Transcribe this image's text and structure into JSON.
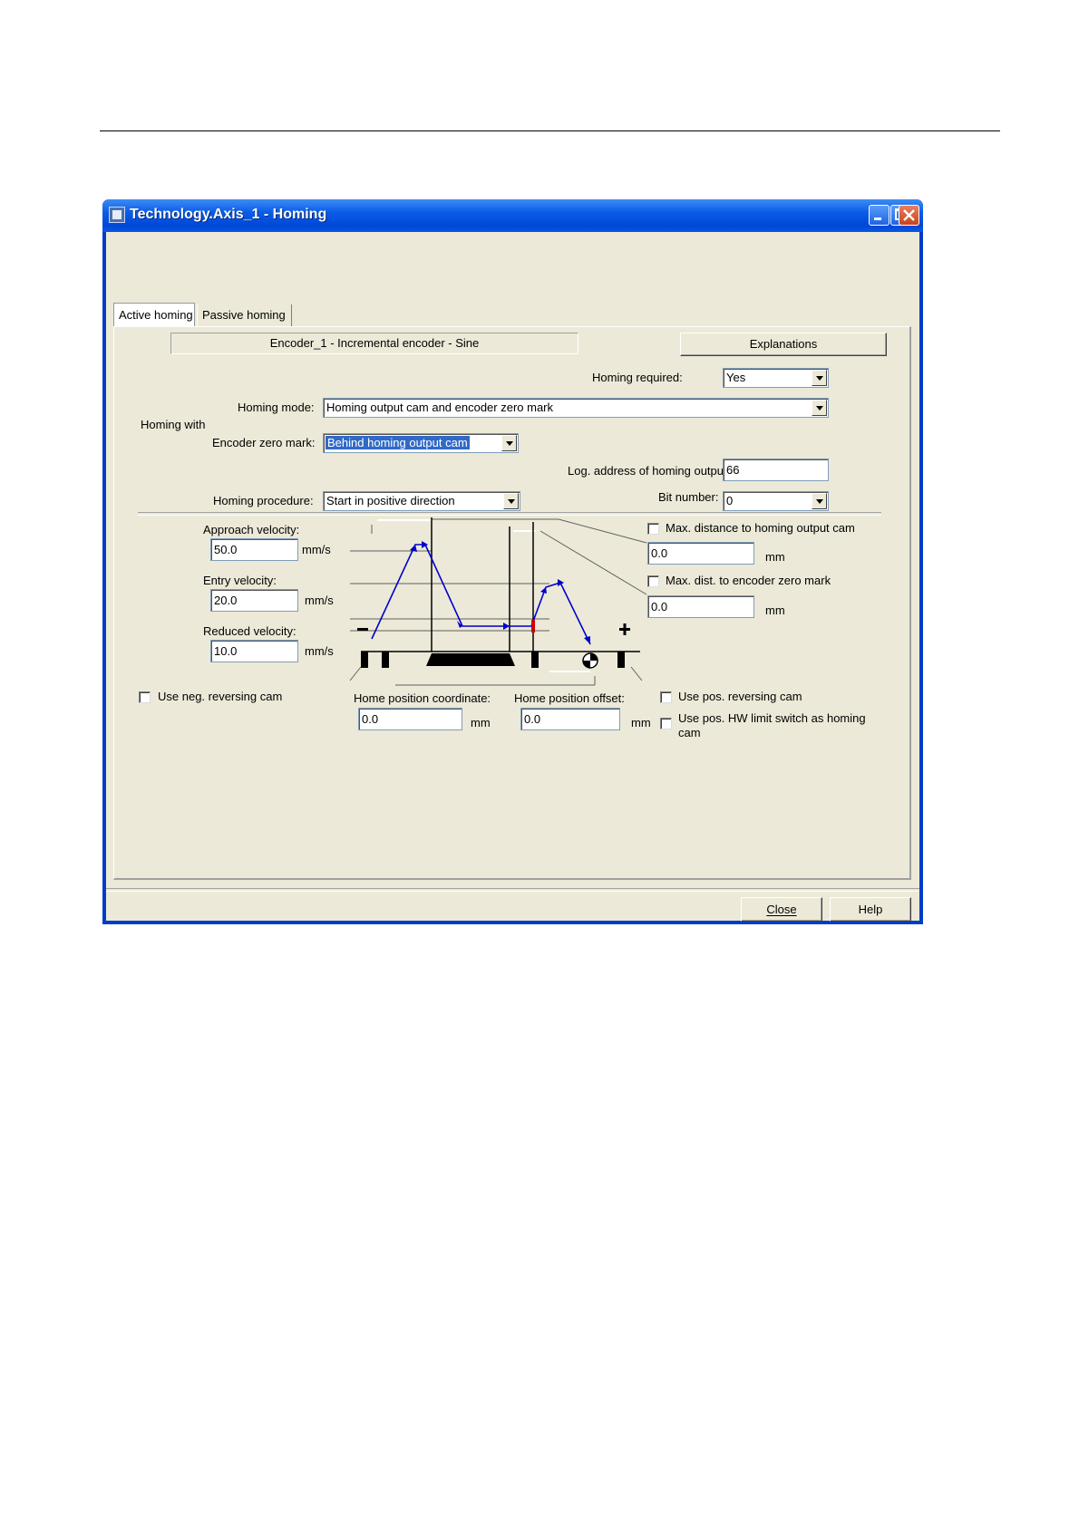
{
  "window": {
    "title": "Technology.Axis_1 - Homing",
    "controls": {
      "minimize_icon": "minimize-icon",
      "maximize_icon": "maximize-icon",
      "close_icon": "close-icon"
    }
  },
  "tabs": [
    {
      "label": "Active homing",
      "active": true
    },
    {
      "label": "Passive homing",
      "active": false
    }
  ],
  "encoder_label": "Encoder_1 - Incremental encoder - Sine",
  "explanations_button": "Explanations",
  "homing_required": {
    "label": "Homing required:",
    "value": "Yes"
  },
  "homing_with_label": "Homing with",
  "homing_mode": {
    "label": "Homing mode:",
    "value": "Homing output cam and encoder zero mark"
  },
  "encoder_zero_mark": {
    "label": "Encoder zero mark:",
    "value": "Behind homing output cam"
  },
  "log_address": {
    "label": "Log. address of homing output",
    "value": "66"
  },
  "homing_procedure": {
    "label": "Homing procedure:",
    "value": "Start in positive direction"
  },
  "bit_number": {
    "label": "Bit number:",
    "value": "0"
  },
  "approach_velocity": {
    "label": "Approach velocity:",
    "value": "50.0",
    "unit": "mm/s"
  },
  "entry_velocity": {
    "label": "Entry velocity:",
    "value": "20.0",
    "unit": "mm/s"
  },
  "reduced_velocity": {
    "label": "Reduced velocity:",
    "value": "10.0",
    "unit": "mm/s"
  },
  "max_distance_cam": {
    "label": "Max. distance to homing output cam",
    "checked": false,
    "value": "0.0",
    "unit": "mm"
  },
  "max_dist_zero_mark": {
    "label": "Max. dist. to encoder zero mark",
    "checked": false,
    "value": "0.0",
    "unit": "mm"
  },
  "use_neg_reversing_cam": {
    "label": "Use neg. reversing cam",
    "checked": false
  },
  "home_position_coordinate": {
    "label": "Home position coordinate:",
    "value": "0.0",
    "unit": "mm"
  },
  "home_position_offset": {
    "label": "Home position offset:",
    "value": "0.0",
    "unit": "mm"
  },
  "use_pos_reversing_cam": {
    "label": "Use pos. reversing cam",
    "checked": false
  },
  "use_pos_hw_limit": {
    "label_line1": "Use pos. HW limit switch as homing",
    "label_line2": "cam",
    "checked": false
  },
  "diagram": {
    "minus_sign": "−",
    "plus_sign": "+",
    "profile_color": "#0000cc",
    "marker_color": "#cc0000"
  },
  "footer": {
    "close_button": "Close",
    "help_button": "Help"
  }
}
